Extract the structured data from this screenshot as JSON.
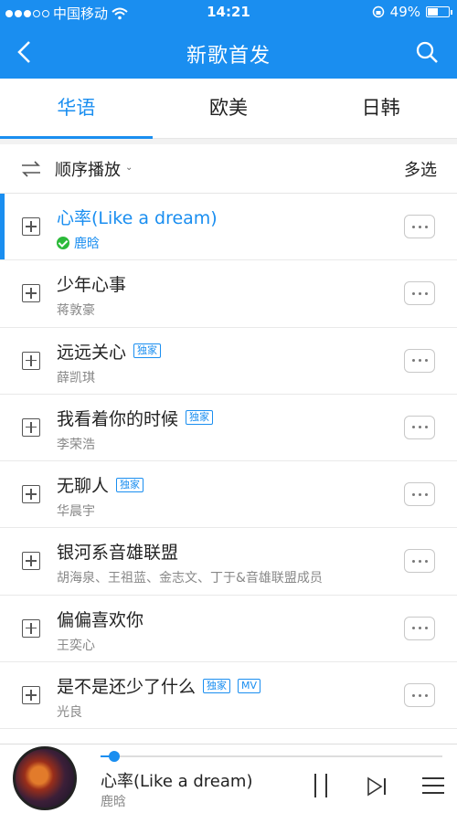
{
  "status_bar": {
    "carrier": "中国移动",
    "time": "14:21",
    "battery": "49%",
    "battery_level": 0.49
  },
  "nav": {
    "title": "新歌首发",
    "back_icon": "chevron-left-icon",
    "search_icon": "search-icon"
  },
  "tabs": [
    {
      "label": "华语",
      "active": true
    },
    {
      "label": "欧美",
      "active": false
    },
    {
      "label": "日韩",
      "active": false
    }
  ],
  "toolbar": {
    "order_label": "顺序播放",
    "multi_label": "多选"
  },
  "songs": [
    {
      "name": "心率(Like a dream)",
      "artist": "鹿晗",
      "badges": [],
      "active": true,
      "downloaded": true
    },
    {
      "name": "少年心事",
      "artist": "蒋敦豪",
      "badges": []
    },
    {
      "name": "远远关心",
      "artist": "薛凯琪",
      "badges": [
        "独家"
      ]
    },
    {
      "name": "我看着你的时候",
      "artist": "李荣浩",
      "badges": [
        "独家"
      ]
    },
    {
      "name": "无聊人",
      "artist": "华晨宇",
      "badges": [
        "独家"
      ]
    },
    {
      "name": "银河系音雄联盟",
      "artist": "胡海泉、王祖蓝、金志文、丁于&音雄联盟成员",
      "badges": []
    },
    {
      "name": "偏偏喜欢你",
      "artist": "王奕心",
      "badges": []
    },
    {
      "name": "是不是还少了什么",
      "artist": "光良",
      "badges": [
        "独家",
        "MV"
      ]
    }
  ],
  "player": {
    "song": "心率(Like a dream)",
    "artist": "鹿晗",
    "progress": 0.03
  },
  "colors": {
    "accent": "#1a8ef0",
    "check": "#2cba3a"
  }
}
